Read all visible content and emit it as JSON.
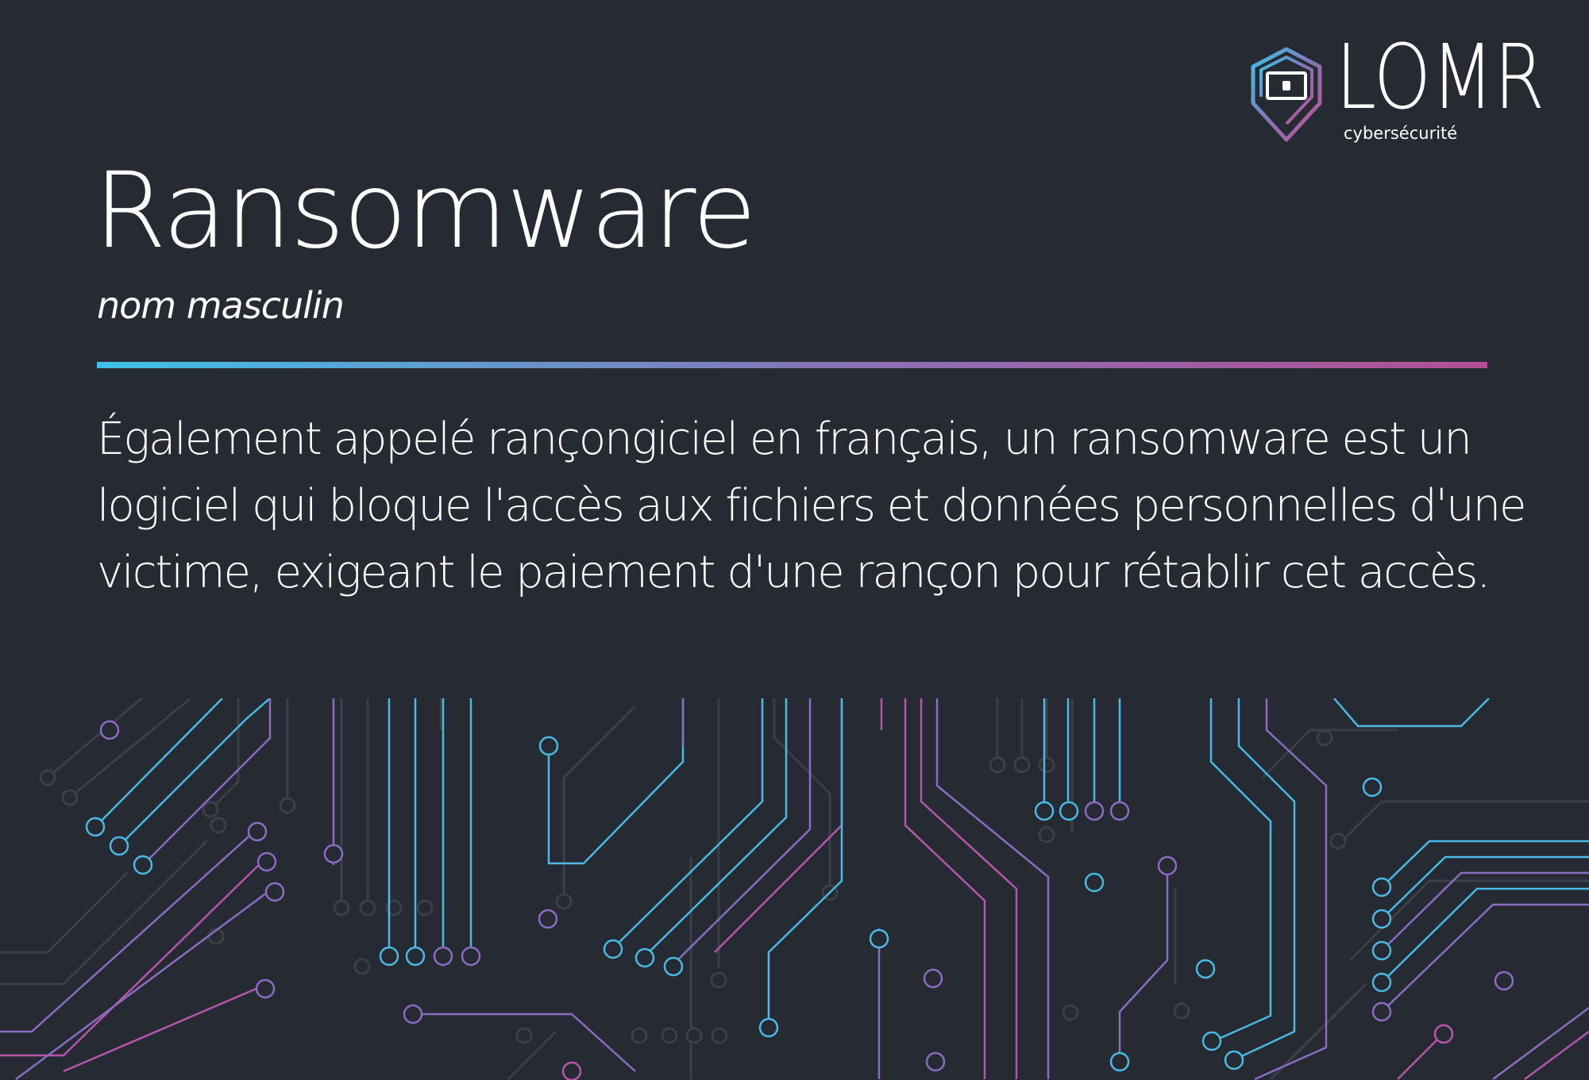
{
  "logo": {
    "name": "LOMR",
    "tagline": "cybersécurité",
    "colors": {
      "cyan": "#3ec1e6",
      "purple": "#8a70b4",
      "magenta": "#b24f94"
    }
  },
  "term": {
    "word": "Ransomware",
    "grammar": "nom masculin"
  },
  "definition": {
    "lines": [
      "Également appelé rançongiciel en français, un ransomware est un",
      "logiciel qui bloque l'accès aux fichiers et données personnelles d'une",
      "victime, exigeant le paiement d'une rançon pour rétablir cet accès."
    ]
  },
  "theme": {
    "background": "#262a33",
    "text": "#ffffff",
    "accent_gradient": [
      "#3ec1e6",
      "#8a70b4",
      "#b24f94"
    ]
  },
  "decoration": {
    "icon": "circuit-board-pattern"
  }
}
